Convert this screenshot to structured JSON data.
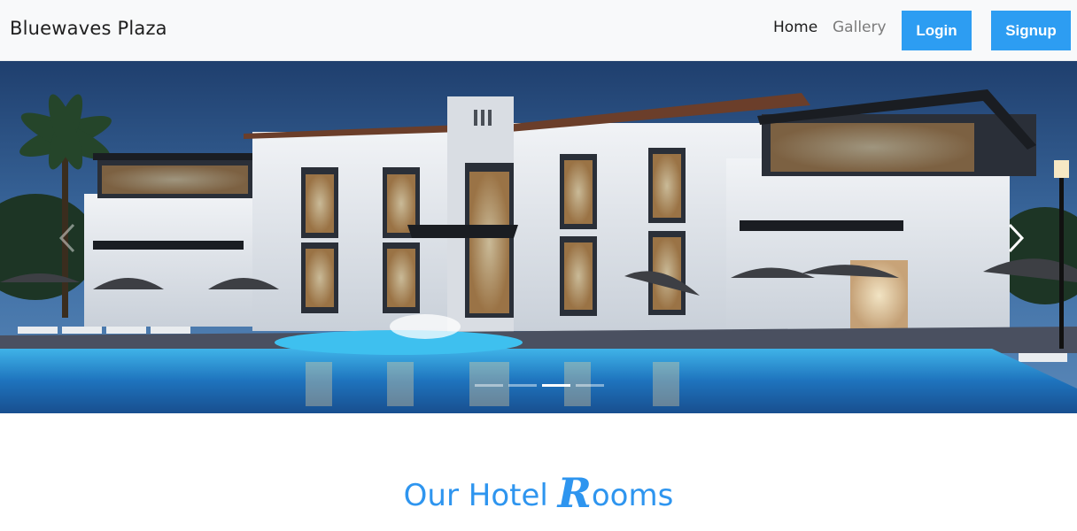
{
  "navbar": {
    "brand": "Bluewaves Plaza",
    "links": [
      {
        "label": "Home"
      },
      {
        "label": "Gallery"
      }
    ],
    "login_label": "Login",
    "signup_label": "Signup",
    "accent_color": "#2d9df2"
  },
  "carousel": {
    "slide_count": 4,
    "active_slide": 3,
    "icons": {
      "prev": "chevron-left-icon",
      "next": "chevron-right-icon"
    }
  },
  "section": {
    "title_prefix": "Our Hotel ",
    "title_fancy_letter": "R",
    "title_suffix": "ooms",
    "color": "#2e95ef"
  }
}
